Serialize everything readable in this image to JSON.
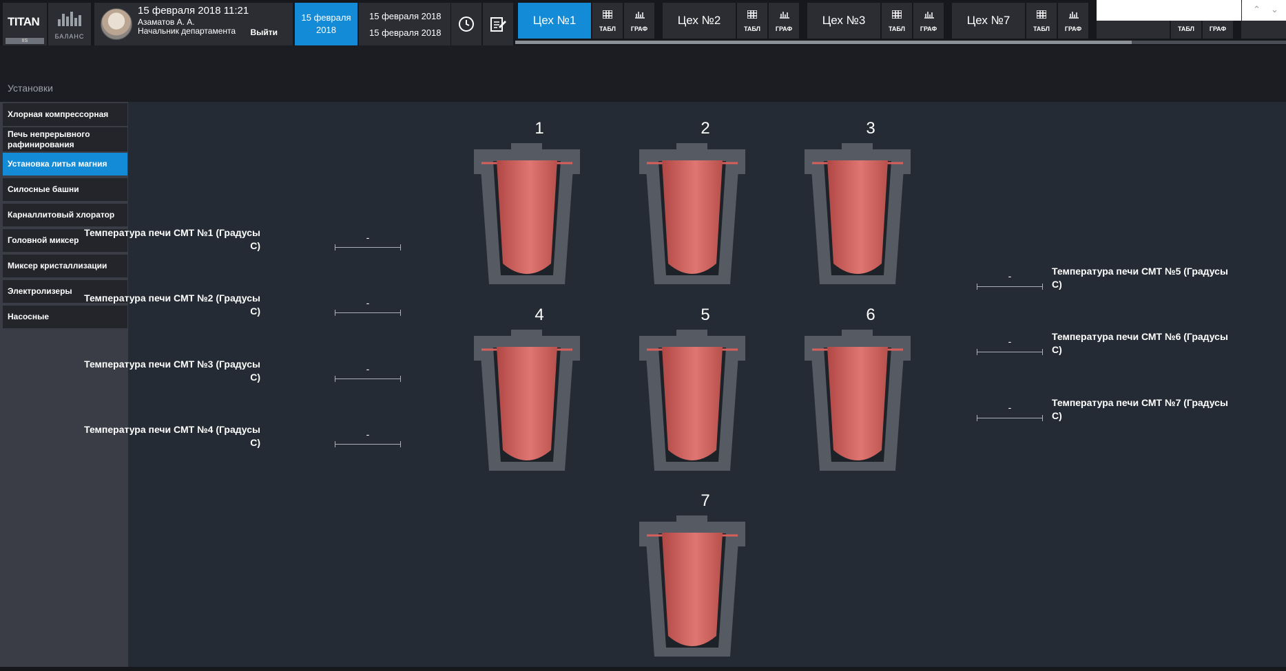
{
  "header": {
    "logo": "TITAN",
    "logo_sub": "IIS",
    "balance_label": "БАЛАНС",
    "user": {
      "datetime": "15 февраля 2018 11:21",
      "name": "Азаматов А. А.",
      "role": "Начальник департамента",
      "logout": "Выйти"
    },
    "today": "15 февраля 2018",
    "range_from": "15 февраля 2018",
    "range_to": "15 февраля 2018",
    "shops": [
      {
        "label": "Цех №1",
        "active": true
      },
      {
        "label": "Цех №2",
        "active": false
      },
      {
        "label": "Цех №3",
        "active": false
      },
      {
        "label": "Цех №7",
        "active": false
      }
    ],
    "table_label": "ТАБЛ",
    "graph_label": "ГРАФ",
    "search_placeholder": ""
  },
  "section_title": "Установки",
  "sidebar": {
    "items": [
      {
        "label": "Хлорная компрессорная",
        "active": false
      },
      {
        "label": "Печь непрерывного рафинирования",
        "active": false
      },
      {
        "label": "Установка литья магния",
        "active": true
      },
      {
        "label": "Силосные башни",
        "active": false
      },
      {
        "label": "Карналлитовый хлоратор",
        "active": false
      },
      {
        "label": "Головной миксер",
        "active": false
      },
      {
        "label": "Миксер кристаллизации",
        "active": false
      },
      {
        "label": "Электролизеры",
        "active": false
      },
      {
        "label": "Насосные",
        "active": false
      }
    ]
  },
  "furnaces": [
    "1",
    "2",
    "3",
    "4",
    "5",
    "6",
    "7"
  ],
  "readings": [
    {
      "label": "Температура печи СМТ №1 (Градусы С)",
      "value": "-"
    },
    {
      "label": "Температура печи СМТ №2 (Градусы С)",
      "value": "-"
    },
    {
      "label": "Температура печи СМТ №3 (Градусы С)",
      "value": "-"
    },
    {
      "label": "Температура печи СМТ №4 (Градусы С)",
      "value": "-"
    },
    {
      "label": "Температура печи СМТ №5 (Градусы С)",
      "value": "-"
    },
    {
      "label": "Температура печи СМТ №6 (Градусы С)",
      "value": "-"
    },
    {
      "label": "Температура печи СМТ №7 (Градусы С)",
      "value": "-"
    }
  ],
  "colors": {
    "accent": "#148bd6",
    "metal": "#d8605c"
  },
  "icons": [
    "balance-chart-icon",
    "clock-icon",
    "report-edit-icon",
    "table-icon",
    "graph-icon",
    "chevron-up-icon",
    "chevron-down-icon"
  ]
}
